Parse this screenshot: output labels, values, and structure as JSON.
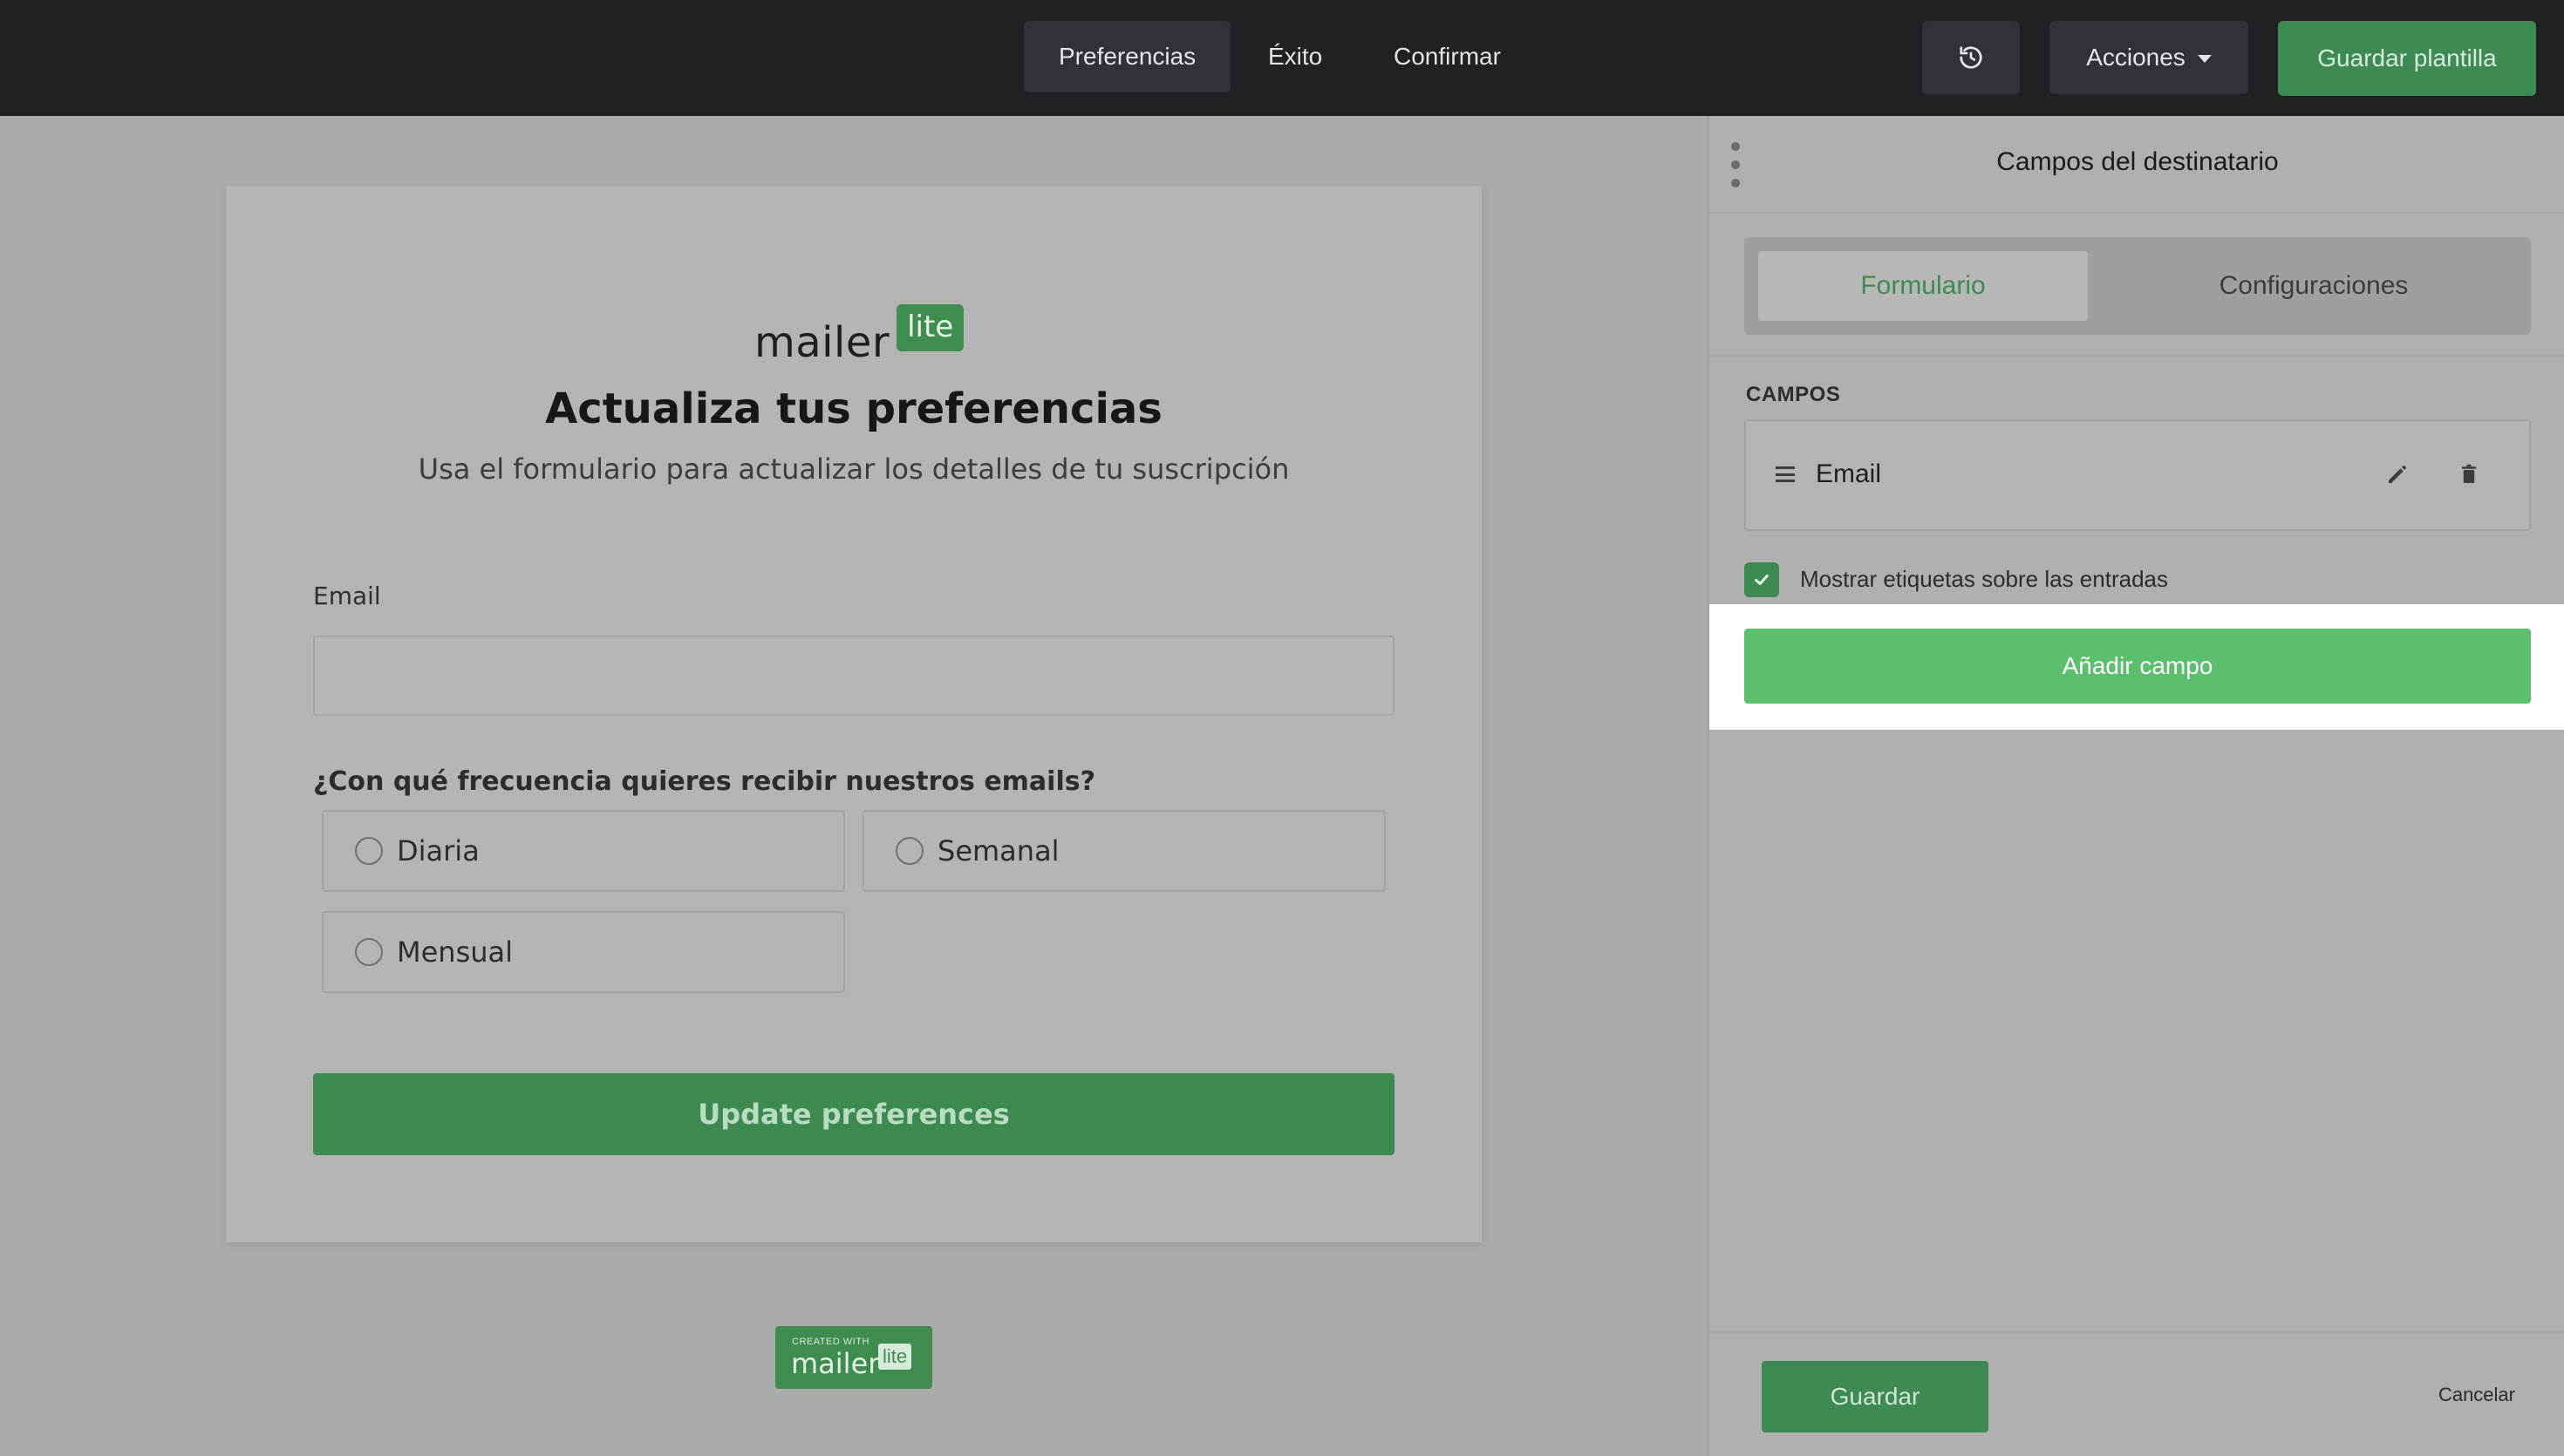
{
  "topbar": {
    "tabs": [
      {
        "label": "Preferencias",
        "active": true
      },
      {
        "label": "Éxito",
        "active": false
      },
      {
        "label": "Confirmar",
        "active": false
      }
    ],
    "history_icon": "history-icon",
    "actions_label": "Acciones",
    "save_template_label": "Guardar plantilla"
  },
  "preview": {
    "logo_text": "mailer",
    "logo_badge": "lite",
    "title": "Actualiza tus preferencias",
    "subtitle": "Usa el formulario para actualizar los detalles de tu suscripción",
    "email_label": "Email",
    "email_value": "",
    "question": "¿Con qué frecuencia quieres recibir nuestros emails?",
    "options": [
      "Diaria",
      "Semanal",
      "Mensual"
    ],
    "submit_label": "Update preferences",
    "created_small": "CREATED WITH",
    "created_main": "mailer",
    "created_lite": "lite"
  },
  "panel": {
    "title": "Campos del destinatario",
    "tabs": [
      {
        "label": "Formulario",
        "active": true
      },
      {
        "label": "Configuraciones",
        "active": false
      }
    ],
    "section_label": "CAMPOS",
    "fields": [
      {
        "label": "Email"
      }
    ],
    "show_labels_checkbox": {
      "label": "Mostrar etiquetas sobre las entradas",
      "checked": true
    },
    "add_field_label": "Añadir campo",
    "save_label": "Guardar",
    "cancel_label": "Cancelar"
  },
  "colors": {
    "brand_green": "#3d8b52",
    "add_button_green": "#5bbf6e",
    "topbar_bg": "#1f2125"
  }
}
